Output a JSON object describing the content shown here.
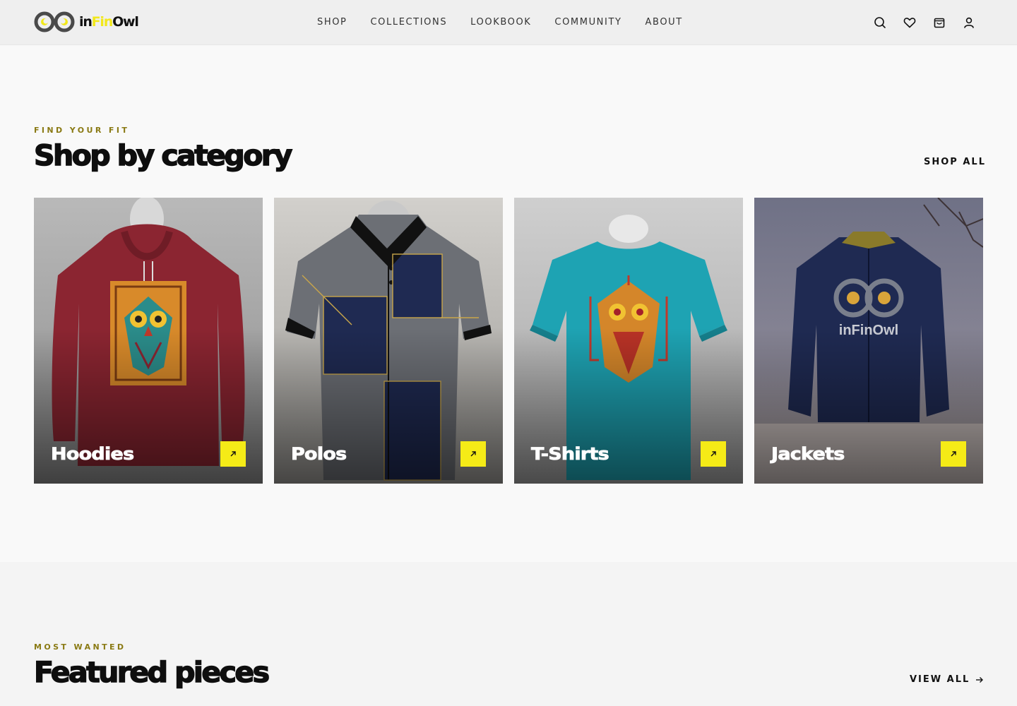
{
  "brand": {
    "name_prefix": "in",
    "name_accent": "Fin",
    "name_suffix": "Owl",
    "accent_color": "#f5eb17"
  },
  "nav": {
    "items": [
      "SHOP",
      "COLLECTIONS",
      "LOOKBOOK",
      "COMMUNITY",
      "ABOUT"
    ]
  },
  "header_icons": [
    "search-icon",
    "heart-icon",
    "bag-icon",
    "user-icon"
  ],
  "categories_section": {
    "eyebrow": "FIND YOUR FIT",
    "title": "Shop by category",
    "cta": "SHOP ALL",
    "cards": [
      {
        "label": "Hoodies",
        "garment_color": "#8b2531"
      },
      {
        "label": "Polos",
        "garment_color": "#5c5f66"
      },
      {
        "label": "T-Shirts",
        "garment_color": "#1ea3b3"
      },
      {
        "label": "Jackets",
        "garment_color": "#1f2a52"
      }
    ]
  },
  "featured_section": {
    "eyebrow": "MOST WANTED",
    "title": "Featured pieces",
    "cta": "VIEW ALL"
  },
  "jacket_print": "inFinOwl"
}
